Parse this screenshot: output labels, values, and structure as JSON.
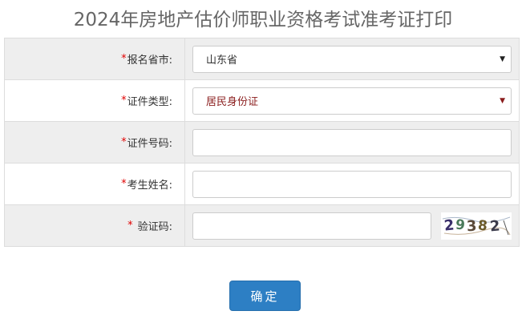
{
  "page": {
    "title": "2024年房地产估价师职业资格考试准考证打印"
  },
  "form": {
    "required_mark": "*",
    "rows": [
      {
        "label": "报名省市:",
        "type": "select",
        "value": "山东省"
      },
      {
        "label": "证件类型:",
        "type": "select",
        "value": "居民身份证"
      },
      {
        "label": "证件号码:",
        "type": "input",
        "value": ""
      },
      {
        "label": "考生姓名:",
        "type": "input",
        "value": ""
      },
      {
        "label": "验证码:",
        "type": "captcha",
        "value": ""
      }
    ],
    "captcha_text": "29382"
  },
  "submit": {
    "label": "确定"
  },
  "colors": {
    "accent": "#2d7fc4",
    "required": "#e00000",
    "row_shade": "#eeeeee"
  },
  "icons": {
    "select_arrow": "triangle-down-icon"
  }
}
